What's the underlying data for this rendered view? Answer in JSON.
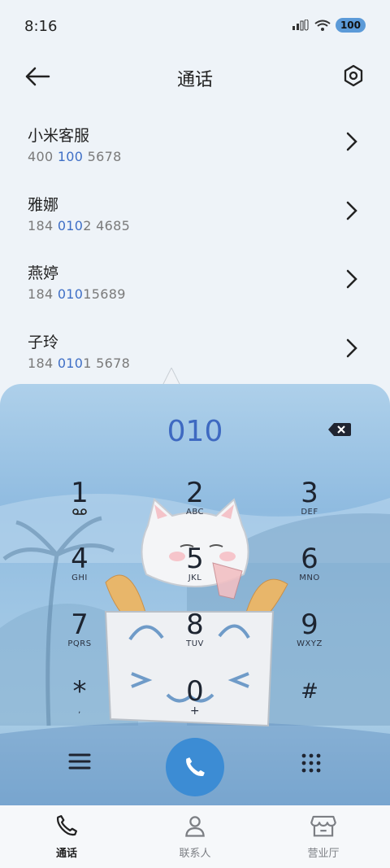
{
  "status": {
    "time": "8:16",
    "battery": "100"
  },
  "header": {
    "title": "通话"
  },
  "contacts": [
    {
      "name": "小米客服",
      "num_a": "400 ",
      "num_hl": "100",
      "num_b": " 5678"
    },
    {
      "name": "雅娜",
      "num_a": "184 ",
      "num_hl": "010",
      "num_b": "2 4685"
    },
    {
      "name": "燕婷",
      "num_a": "184 ",
      "num_hl": "010",
      "num_b": "15689"
    },
    {
      "name": "子玲",
      "num_a": "184 ",
      "num_hl": "010",
      "num_b": "1 5678"
    }
  ],
  "dialer": {
    "input": "010",
    "keys": [
      {
        "digit": "1",
        "letters": ""
      },
      {
        "digit": "2",
        "letters": "ABC"
      },
      {
        "digit": "3",
        "letters": "DEF"
      },
      {
        "digit": "4",
        "letters": "GHI"
      },
      {
        "digit": "5",
        "letters": "JKL"
      },
      {
        "digit": "6",
        "letters": "MNO"
      },
      {
        "digit": "7",
        "letters": "PQRS"
      },
      {
        "digit": "8",
        "letters": "TUV"
      },
      {
        "digit": "9",
        "letters": "WXYZ"
      },
      {
        "digit": "*",
        "letters": ","
      },
      {
        "digit": "0",
        "letters": "+"
      },
      {
        "digit": "#",
        "letters": ""
      }
    ]
  },
  "bottom_nav": [
    {
      "label": "通话",
      "active": true
    },
    {
      "label": "联系人",
      "active": false
    },
    {
      "label": "营业厅",
      "active": false
    }
  ],
  "colors": {
    "accent": "#3e69c1",
    "call": "#3c8cd4"
  }
}
